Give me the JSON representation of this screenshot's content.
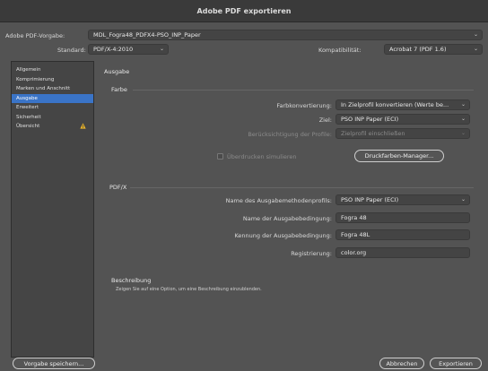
{
  "window": {
    "title": "Adobe PDF exportieren"
  },
  "top": {
    "preset_label": "Adobe PDF-Vorgabe:",
    "preset_value": "MDL_Fogra48_PDFX4-PSO_INP_Paper",
    "standard_label": "Standard:",
    "standard_value": "PDF/X-4:2010",
    "compat_label": "Kompatibilität:",
    "compat_value": "Acrobat 7 (PDF 1.6)"
  },
  "sidebar": {
    "items": [
      {
        "label": "Allgemein"
      },
      {
        "label": "Komprimierung"
      },
      {
        "label": "Marken und Anschnitt"
      },
      {
        "label": "Ausgabe"
      },
      {
        "label": "Erweitert"
      },
      {
        "label": "Sicherheit"
      },
      {
        "label": "Übersicht"
      }
    ],
    "selected_index": 3
  },
  "main": {
    "heading": "Ausgabe",
    "farbe": {
      "title": "Farbe",
      "conv_label": "Farbkonvertierung:",
      "conv_value": "In Zielprofil konvertieren (Werte be...",
      "ziel_label": "Ziel:",
      "ziel_value": "PSO INP Paper (ECI)",
      "profile_label": "Berücksichtigung der Profile:",
      "profile_value": "Zielprofil einschließen",
      "overprint_label": "Überdrucken simulieren",
      "ink_manager_label": "Druckfarben-Manager..."
    },
    "pdfx": {
      "title": "PDF/X",
      "profile_name_label": "Name des Ausgabemethodenprofils:",
      "profile_name_value": "PSO INP Paper (ECI)",
      "condition_name_label": "Name der Ausgabebedingung:",
      "condition_name_value": "Fogra 48",
      "condition_id_label": "Kennung der Ausgabebedingung:",
      "condition_id_value": "Fogra 48L",
      "registry_label": "Registrierung:",
      "registry_value": "color.org"
    },
    "description": {
      "title": "Beschreibung",
      "text": "Zeigen Sie auf eine Option, um eine Beschreibung einzublenden."
    }
  },
  "footer": {
    "save_preset": "Vorgabe speichern...",
    "cancel": "Abbrechen",
    "export": "Exportieren"
  }
}
